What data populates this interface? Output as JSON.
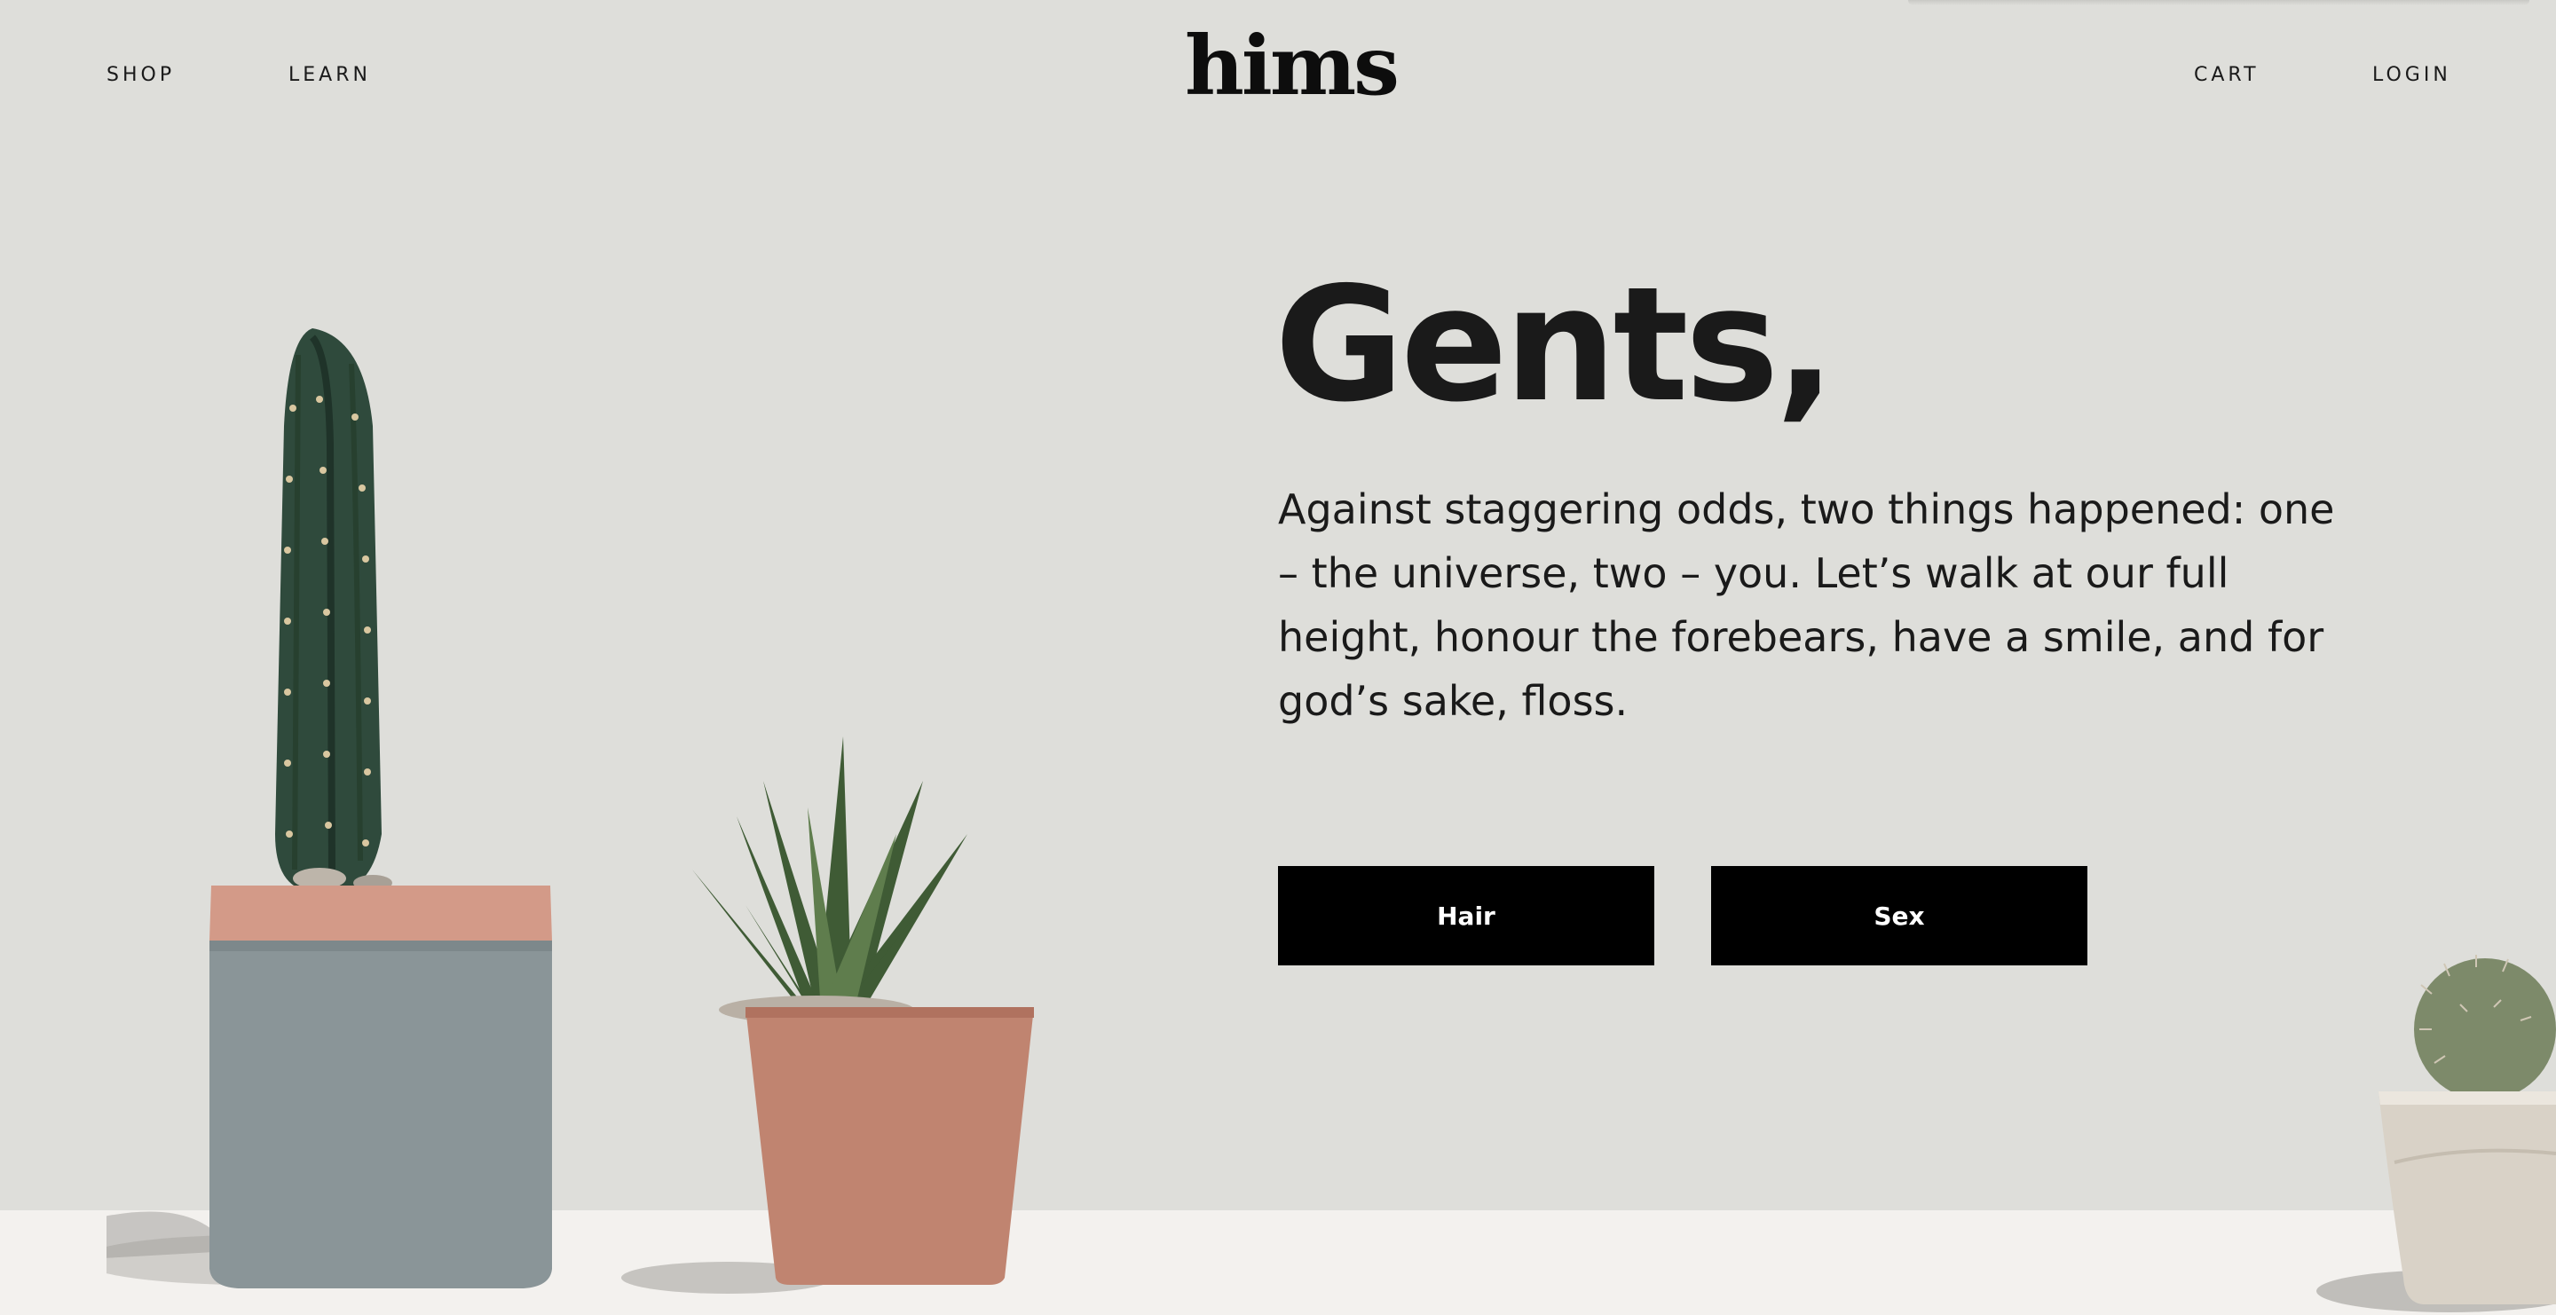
{
  "header": {
    "nav_left": [
      "SHOP",
      "LEARN"
    ],
    "logo": "hims",
    "nav_right": [
      "CART",
      "LOGIN"
    ]
  },
  "hero": {
    "title": "Gents,",
    "body": "Against staggering odds, two things happened: one – the universe, two – you. Let’s walk at our full height, honour the forebears, have a smile, and for god’s sake, floss.",
    "buttons": [
      "Hair",
      "Sex"
    ]
  },
  "colors": {
    "background": "#dededa",
    "floor": "#f3f1ee",
    "button_bg": "#000000",
    "button_text": "#ffffff",
    "text": "#1a1a1a"
  },
  "images": {
    "left_plant": "tall-cactus-in-grey-pot",
    "middle_plant": "aloe-succulent-in-terracotta-pot",
    "right_plant": "round-cactus-in-cream-bowl"
  }
}
